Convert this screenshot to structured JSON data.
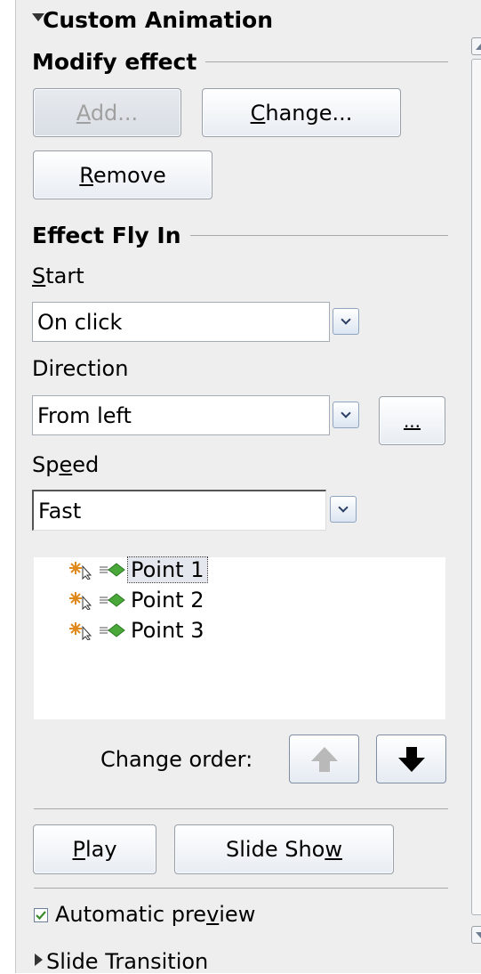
{
  "header": {
    "title": "Custom Animation"
  },
  "modify_effect": {
    "section_title": "Modify effect",
    "add_label": "Add...",
    "change_label": "Change...",
    "remove_label": "Remove"
  },
  "effect": {
    "section_title": "Effect Fly In",
    "start_label": "Start",
    "start_value": "On click",
    "direction_label": "Direction",
    "direction_value": "From left",
    "options_label": "...",
    "speed_label": "Speed",
    "speed_value": "Fast"
  },
  "effects_list": {
    "items": [
      "Point 1",
      "Point 2",
      "Point 3"
    ],
    "selected_index": 0
  },
  "change_order": {
    "label": "Change order:"
  },
  "actions": {
    "play_label": "Play",
    "slideshow_label": "Slide Show"
  },
  "automatic_preview": {
    "label": "Automatic preview",
    "checked": true
  },
  "footer": {
    "next_panel_title": "Slide Transition"
  },
  "icons": {
    "header": "collapse-triangle-icon",
    "footer": "expand-triangle-icon",
    "list": [
      "on-click-trigger-icon",
      "fly-in-effect-icon"
    ],
    "order": [
      "move-up-arrow-icon",
      "move-down-arrow-icon"
    ]
  }
}
